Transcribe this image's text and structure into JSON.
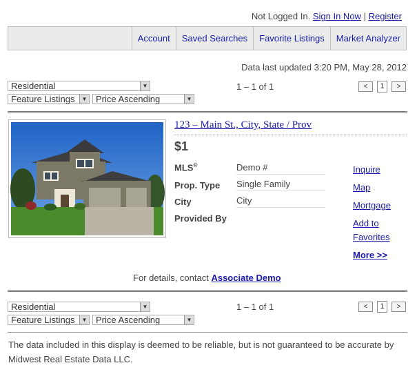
{
  "login": {
    "status": "Not Logged In.",
    "sign_in": "Sign In Now",
    "separator": "|",
    "register": "Register"
  },
  "nav": {
    "tabs": [
      "Account",
      "Saved Searches",
      "Favorite Listings",
      "Market Analyzer"
    ]
  },
  "updated": "Data last updated 3:20 PM, May 28, 2012",
  "controls": {
    "property_type": "Residential",
    "listing_type": "Feature Listings",
    "sort": "Price Ascending",
    "count": "1 – 1 of 1",
    "prev": "<",
    "page": "1",
    "next": ">"
  },
  "listing": {
    "address": "123 – Main St., City, State / Prov",
    "price": "$1",
    "fields": [
      {
        "label": "MLS",
        "sup": "®",
        "value": "Demo #"
      },
      {
        "label": "Prop. Type",
        "value": "Single Family"
      },
      {
        "label": "City",
        "value": "City"
      },
      {
        "label": "Provided By",
        "value": ""
      }
    ],
    "actions": {
      "inquire": "Inquire",
      "map": "Map",
      "mortgage": "Mortgage",
      "add_to": "Add to",
      "favorites": "Favorites",
      "more": "More >>"
    },
    "contact_prefix": "For details, contact",
    "contact_name": "Associate Demo"
  },
  "disclaimer": "The data included in this display is deemed to be reliable, but is not guaranteed to be accurate by Midwest Real Estate Data LLC."
}
